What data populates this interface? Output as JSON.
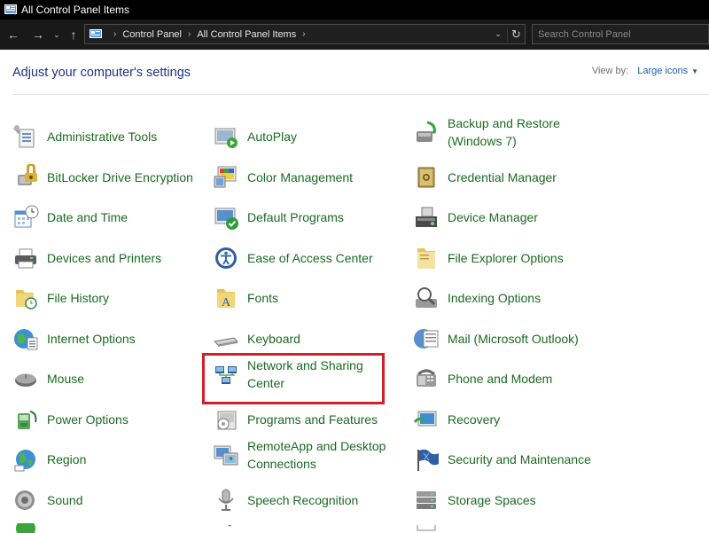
{
  "window": {
    "title": "All Control Panel Items"
  },
  "nav": {
    "breadcrumb": [
      "Control Panel",
      "All Control Panel Items"
    ],
    "search_placeholder": "Search Control Panel"
  },
  "header": {
    "title": "Adjust your computer's settings",
    "view_by_label": "View by:",
    "view_by_value": "Large icons"
  },
  "colors": {
    "link": "#1b6a21",
    "title": "#1e3287",
    "highlight": "#d21f2a"
  },
  "items": {
    "col1": [
      {
        "label": "Administrative Tools",
        "icon": "admin-tools-icon"
      },
      {
        "label": "BitLocker Drive Encryption",
        "icon": "bitlocker-icon"
      },
      {
        "label": "Date and Time",
        "icon": "date-time-icon"
      },
      {
        "label": "Devices and Printers",
        "icon": "printer-icon"
      },
      {
        "label": "File History",
        "icon": "file-history-icon"
      },
      {
        "label": "Internet Options",
        "icon": "internet-options-icon"
      },
      {
        "label": "Mouse",
        "icon": "mouse-icon"
      },
      {
        "label": "Power Options",
        "icon": "power-options-icon"
      },
      {
        "label": "Region",
        "icon": "region-icon"
      },
      {
        "label": "Sound",
        "icon": "sound-icon"
      }
    ],
    "col2": [
      {
        "label": "AutoPlay",
        "icon": "autoplay-icon"
      },
      {
        "label": "Color Management",
        "icon": "color-management-icon"
      },
      {
        "label": "Default Programs",
        "icon": "default-programs-icon"
      },
      {
        "label": "Ease of Access Center",
        "icon": "ease-of-access-icon"
      },
      {
        "label": "Fonts",
        "icon": "fonts-icon"
      },
      {
        "label": "Keyboard",
        "icon": "keyboard-icon"
      },
      {
        "label": "Network and Sharing Center",
        "icon": "network-icon"
      },
      {
        "label": "Programs and Features",
        "icon": "programs-features-icon"
      },
      {
        "label": "RemoteApp and Desktop Connections",
        "icon": "remoteapp-icon"
      },
      {
        "label": "Speech Recognition",
        "icon": "microphone-icon"
      }
    ],
    "col3": [
      {
        "label": "Backup and Restore (Windows 7)",
        "icon": "backup-restore-icon"
      },
      {
        "label": "Credential Manager",
        "icon": "credential-manager-icon"
      },
      {
        "label": "Device Manager",
        "icon": "device-manager-icon"
      },
      {
        "label": "File Explorer Options",
        "icon": "folder-options-icon"
      },
      {
        "label": "Indexing Options",
        "icon": "indexing-options-icon"
      },
      {
        "label": "Mail (Microsoft Outlook)",
        "icon": "mail-icon"
      },
      {
        "label": "Phone and Modem",
        "icon": "phone-modem-icon"
      },
      {
        "label": "Recovery",
        "icon": "recovery-icon"
      },
      {
        "label": "Security and Maintenance",
        "icon": "security-flag-icon"
      },
      {
        "label": "Storage Spaces",
        "icon": "storage-spaces-icon"
      }
    ]
  }
}
